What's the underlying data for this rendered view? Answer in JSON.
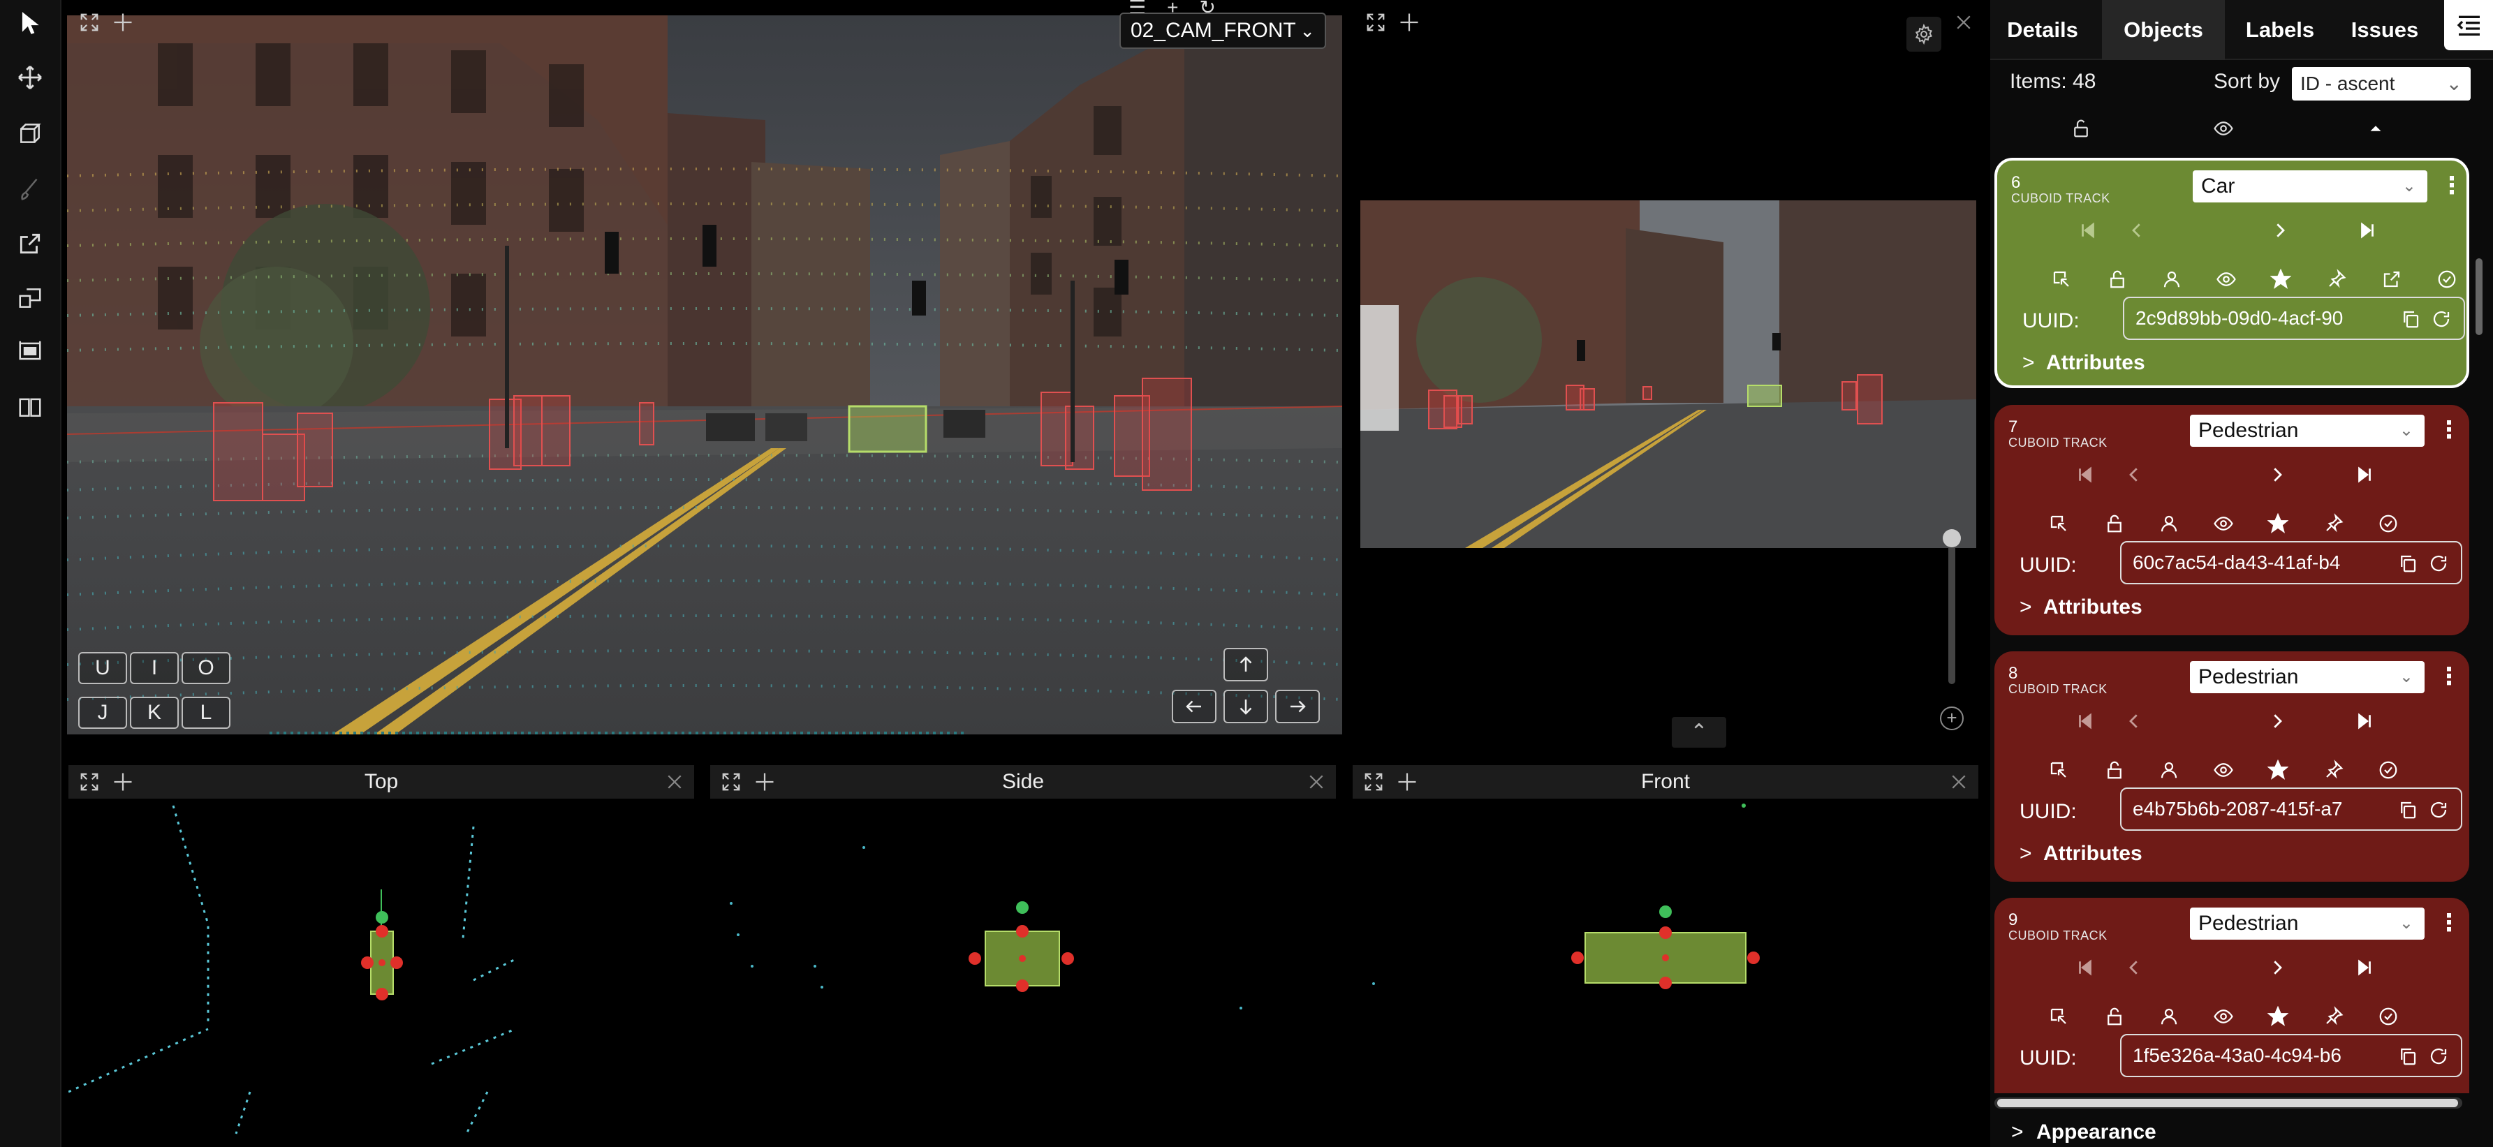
{
  "toolbar": {
    "tools": [
      "pointer-icon",
      "move-icon",
      "cuboid-icon",
      "brush-icon",
      "export-icon",
      "split-view-icon",
      "frame-view-icon",
      "book-icon"
    ]
  },
  "camera": {
    "selected": "02_CAM_FRONT",
    "keys_top": [
      "U",
      "I",
      "O"
    ],
    "keys_bottom": [
      "J",
      "K",
      "L"
    ]
  },
  "views": {
    "top": "Top",
    "side": "Side",
    "front": "Front"
  },
  "panel": {
    "tabs": [
      "Details",
      "Objects",
      "Labels",
      "Issues"
    ],
    "active_tab": "Objects",
    "items_label": "Items: 48",
    "sort_label": "Sort by",
    "sort_value": "ID - ascent",
    "attributes_label": "Attributes",
    "uuid_label": "UUID:",
    "appearance_label": "Appearance"
  },
  "cards": [
    {
      "id": "6",
      "type": "CUBOID TRACK",
      "label": "Car",
      "uuid": "2c9d89bb-09d0-4acf-90",
      "color": "#6c8a33"
    },
    {
      "id": "7",
      "type": "CUBOID TRACK",
      "label": "Pedestrian",
      "uuid": "60c7ac54-da43-41af-b4",
      "color": "#6f1b17"
    },
    {
      "id": "8",
      "type": "CUBOID TRACK",
      "label": "Pedestrian",
      "uuid": "e4b75b6b-2087-415f-a7",
      "color": "#6f1b17"
    },
    {
      "id": "9",
      "type": "CUBOID TRACK",
      "label": "Pedestrian",
      "uuid": "1f5e326a-43a0-4c94-b6",
      "color": "#6f1b17"
    }
  ],
  "colors": {
    "car": "#6c8a33",
    "pedestrian": "#6f1b17",
    "handle_red": "#e0302a",
    "handle_green": "#3fbf5a"
  }
}
